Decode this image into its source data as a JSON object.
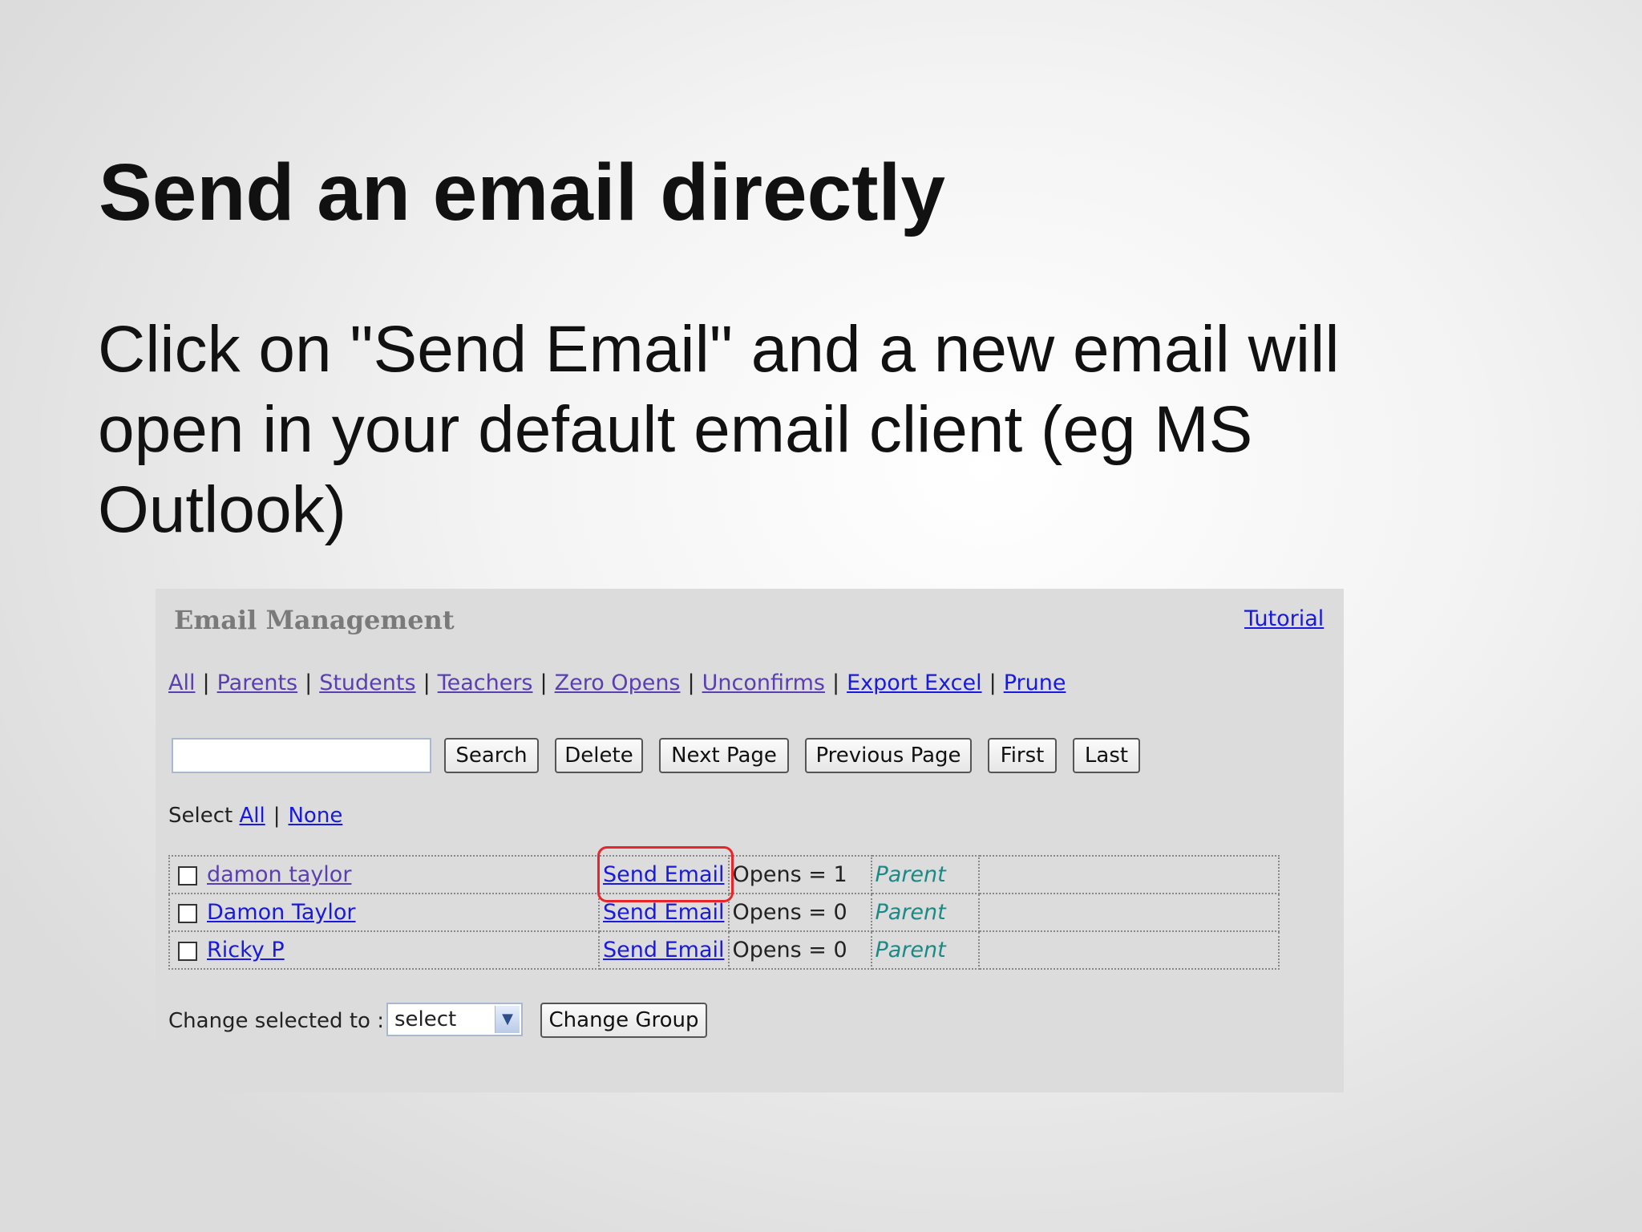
{
  "slide": {
    "title": "Send an email directly",
    "body": "Click on \"Send Email\" and a new email will open in your default email client (eg MS Outlook)"
  },
  "app": {
    "title": "Email Management",
    "tutorial_link": "Tutorial",
    "filters": [
      "All",
      "Parents",
      "Students",
      "Teachers",
      "Zero Opens",
      "Unconfirms",
      "Export Excel",
      "Prune"
    ],
    "search": {
      "value": "",
      "placeholder": ""
    },
    "buttons": {
      "search": "Search",
      "delete": "Delete",
      "next_page": "Next Page",
      "previous_page": "Previous Page",
      "first": "First",
      "last": "Last"
    },
    "select": {
      "label": "Select",
      "all": "All",
      "none": "None"
    },
    "rows": [
      {
        "name": "damon taylor",
        "action": "Send Email",
        "opens": "Opens = 1",
        "role": "Parent",
        "highlighted": true
      },
      {
        "name": "Damon Taylor",
        "action": "Send Email",
        "opens": "Opens = 0",
        "role": "Parent",
        "highlighted": false
      },
      {
        "name": "Ricky P",
        "action": "Send Email",
        "opens": "Opens = 0",
        "role": "Parent",
        "highlighted": false
      }
    ],
    "change": {
      "label": "Change selected to :",
      "selected_option": "select",
      "button": "Change Group"
    }
  },
  "colors": {
    "highlight": "#e8262a",
    "link": "#1a1add",
    "role_text": "#1a8a86"
  }
}
